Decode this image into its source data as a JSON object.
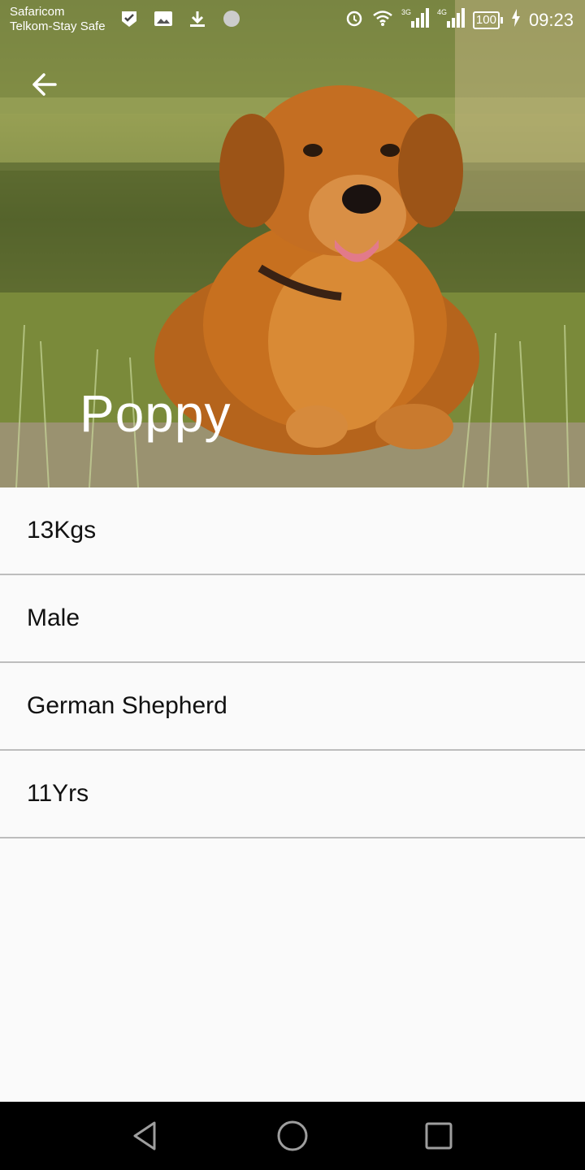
{
  "status_bar": {
    "carrier_1": "Safaricom",
    "carrier_2": "Telkom-Stay Safe",
    "left_icons": [
      "shield-check-icon",
      "image-icon",
      "download-icon",
      "dot-icon"
    ],
    "right_icons": [
      "alarm-icon",
      "wifi-icon",
      "signal-3g-icon",
      "signal-4g-icon",
      "battery-icon",
      "charging-icon"
    ],
    "network_3g": "3G",
    "network_4g": "4G",
    "battery": "100",
    "time": "09:23"
  },
  "header": {
    "back_icon": "arrow-left-icon",
    "pet_name": "Poppy"
  },
  "details": [
    {
      "label": "13Kgs"
    },
    {
      "label": "Male"
    },
    {
      "label": "German Shepherd"
    },
    {
      "label": "11Yrs"
    }
  ],
  "nav_bar": {
    "icons": [
      "back-triangle-icon",
      "home-circle-icon",
      "recents-square-icon"
    ]
  },
  "colors": {
    "background": "#fafafa",
    "divider": "#bdbdbd",
    "nav_bar": "#000000",
    "dog_fur": "#c7701f"
  }
}
